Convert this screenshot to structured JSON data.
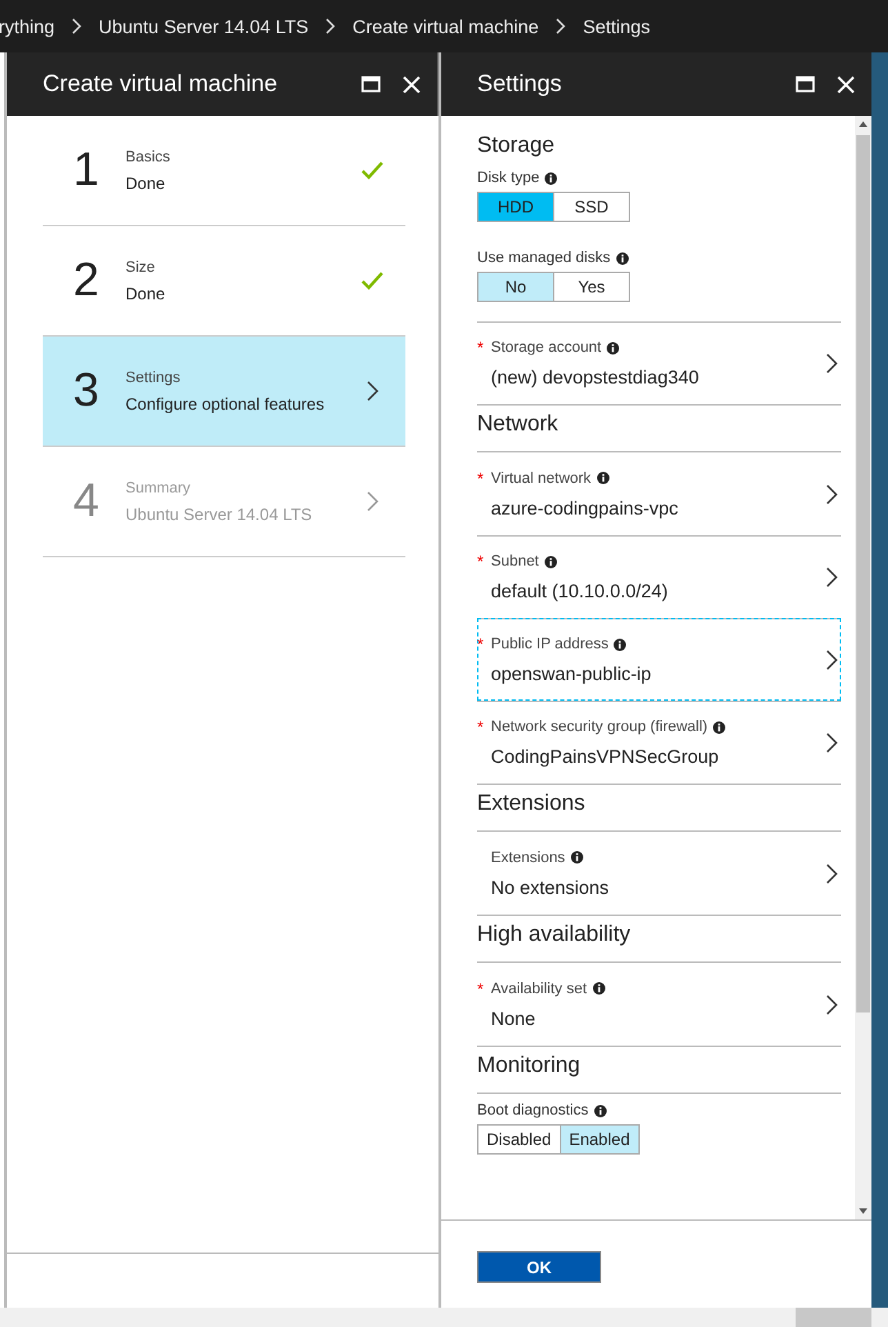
{
  "breadcrumb": [
    "rything",
    "Ubuntu Server 14.04 LTS",
    "Create virtual machine",
    "Settings"
  ],
  "create_blade": {
    "title": "Create virtual machine",
    "steps": [
      {
        "number": "1",
        "title": "Basics",
        "subtitle": "Done",
        "completed": true,
        "selected": false,
        "disabled": false
      },
      {
        "number": "2",
        "title": "Size",
        "subtitle": "Done",
        "completed": true,
        "selected": false,
        "disabled": false
      },
      {
        "number": "3",
        "title": "Settings",
        "subtitle": "Configure optional features",
        "completed": false,
        "selected": true,
        "disabled": false
      },
      {
        "number": "4",
        "title": "Summary",
        "subtitle": "Ubuntu Server 14.04 LTS",
        "completed": false,
        "selected": false,
        "disabled": true
      }
    ]
  },
  "settings_blade": {
    "title": "Settings",
    "sections": [
      {
        "heading": "Storage",
        "items": [
          {
            "kind": "toggle",
            "label": "Disk type",
            "focused": true,
            "options": [
              {
                "label": "HDD",
                "selected": true
              },
              {
                "label": "SSD",
                "selected": false
              }
            ]
          },
          {
            "kind": "toggle",
            "label": "Use managed disks",
            "focused": false,
            "options": [
              {
                "label": "No",
                "selected": true
              },
              {
                "label": "Yes",
                "selected": false
              }
            ]
          },
          {
            "kind": "link",
            "label": "Storage account",
            "value": "(new) devopstestdiag340",
            "required_mark": "*",
            "focused": false
          }
        ]
      },
      {
        "heading": "Network",
        "items": [
          {
            "kind": "link",
            "label": "Virtual network",
            "value": "azure-codingpains-vpc",
            "required_mark": "*",
            "focused": false
          },
          {
            "kind": "link",
            "label": "Subnet",
            "value": "default (10.10.0.0/24)",
            "required_mark": "*",
            "focused": false
          },
          {
            "kind": "link",
            "label": "Public IP address",
            "value": "openswan-public-ip",
            "required_mark": "*",
            "focused": true
          },
          {
            "kind": "link",
            "label": "Network security group (firewall)",
            "value": "CodingPainsVPNSecGroup",
            "required_mark": "*",
            "focused": false
          }
        ]
      },
      {
        "heading": "Extensions",
        "items": [
          {
            "kind": "link",
            "label": "Extensions",
            "value": "No extensions",
            "focused": false
          }
        ]
      },
      {
        "heading": "High availability",
        "items": [
          {
            "kind": "link",
            "label": "Availability set",
            "value": "None",
            "required_mark": "*",
            "focused": false
          }
        ]
      },
      {
        "heading": "Monitoring",
        "items": [
          {
            "kind": "toggle",
            "label": "Boot diagnostics",
            "focused": false,
            "options": [
              {
                "label": "Disabled",
                "selected": false
              },
              {
                "label": "Enabled",
                "selected": true
              }
            ]
          }
        ]
      }
    ],
    "ok_button": "OK"
  }
}
